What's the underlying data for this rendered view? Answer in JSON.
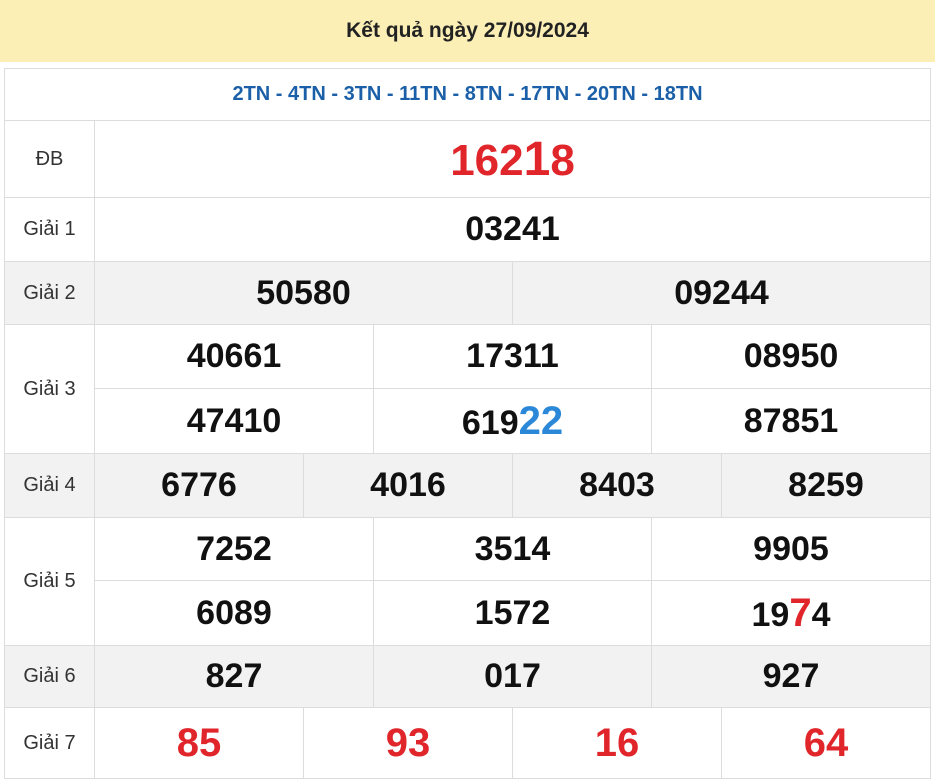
{
  "header": {
    "title": "Kết quả ngày 27/09/2024"
  },
  "codes": "2TN - 4TN - 3TN - 11TN - 8TN - 17TN - 20TN - 18TN",
  "prizes": {
    "db": {
      "label": "ĐB",
      "prefix": "162",
      "big": "1",
      "suffix": "8"
    },
    "g1": {
      "label": "Giải 1",
      "values": [
        "03241"
      ]
    },
    "g2": {
      "label": "Giải 2",
      "values": [
        "50580",
        "09244"
      ]
    },
    "g3": {
      "label": "Giải 3",
      "values": [
        "40661",
        "17311",
        "08950",
        "47410",
        "619",
        "87851"
      ],
      "highlight": "22"
    },
    "g4": {
      "label": "Giải 4",
      "values": [
        "6776",
        "4016",
        "8403",
        "8259"
      ]
    },
    "g5": {
      "label": "Giải 5",
      "values": [
        "7252",
        "3514",
        "9905",
        "6089",
        "1572",
        "19"
      ],
      "highlight": "7",
      "tail": "4"
    },
    "g6": {
      "label": "Giải 6",
      "values": [
        "827",
        "017",
        "927"
      ]
    },
    "g7": {
      "label": "Giải 7",
      "values": [
        "85",
        "93",
        "16",
        "64"
      ]
    }
  },
  "colors": {
    "header_bg": "#fbefb6",
    "codes": "#1a5fa8",
    "red": "#e0262b",
    "blue": "#2b88d8",
    "stripe": "#f2f2f2"
  }
}
